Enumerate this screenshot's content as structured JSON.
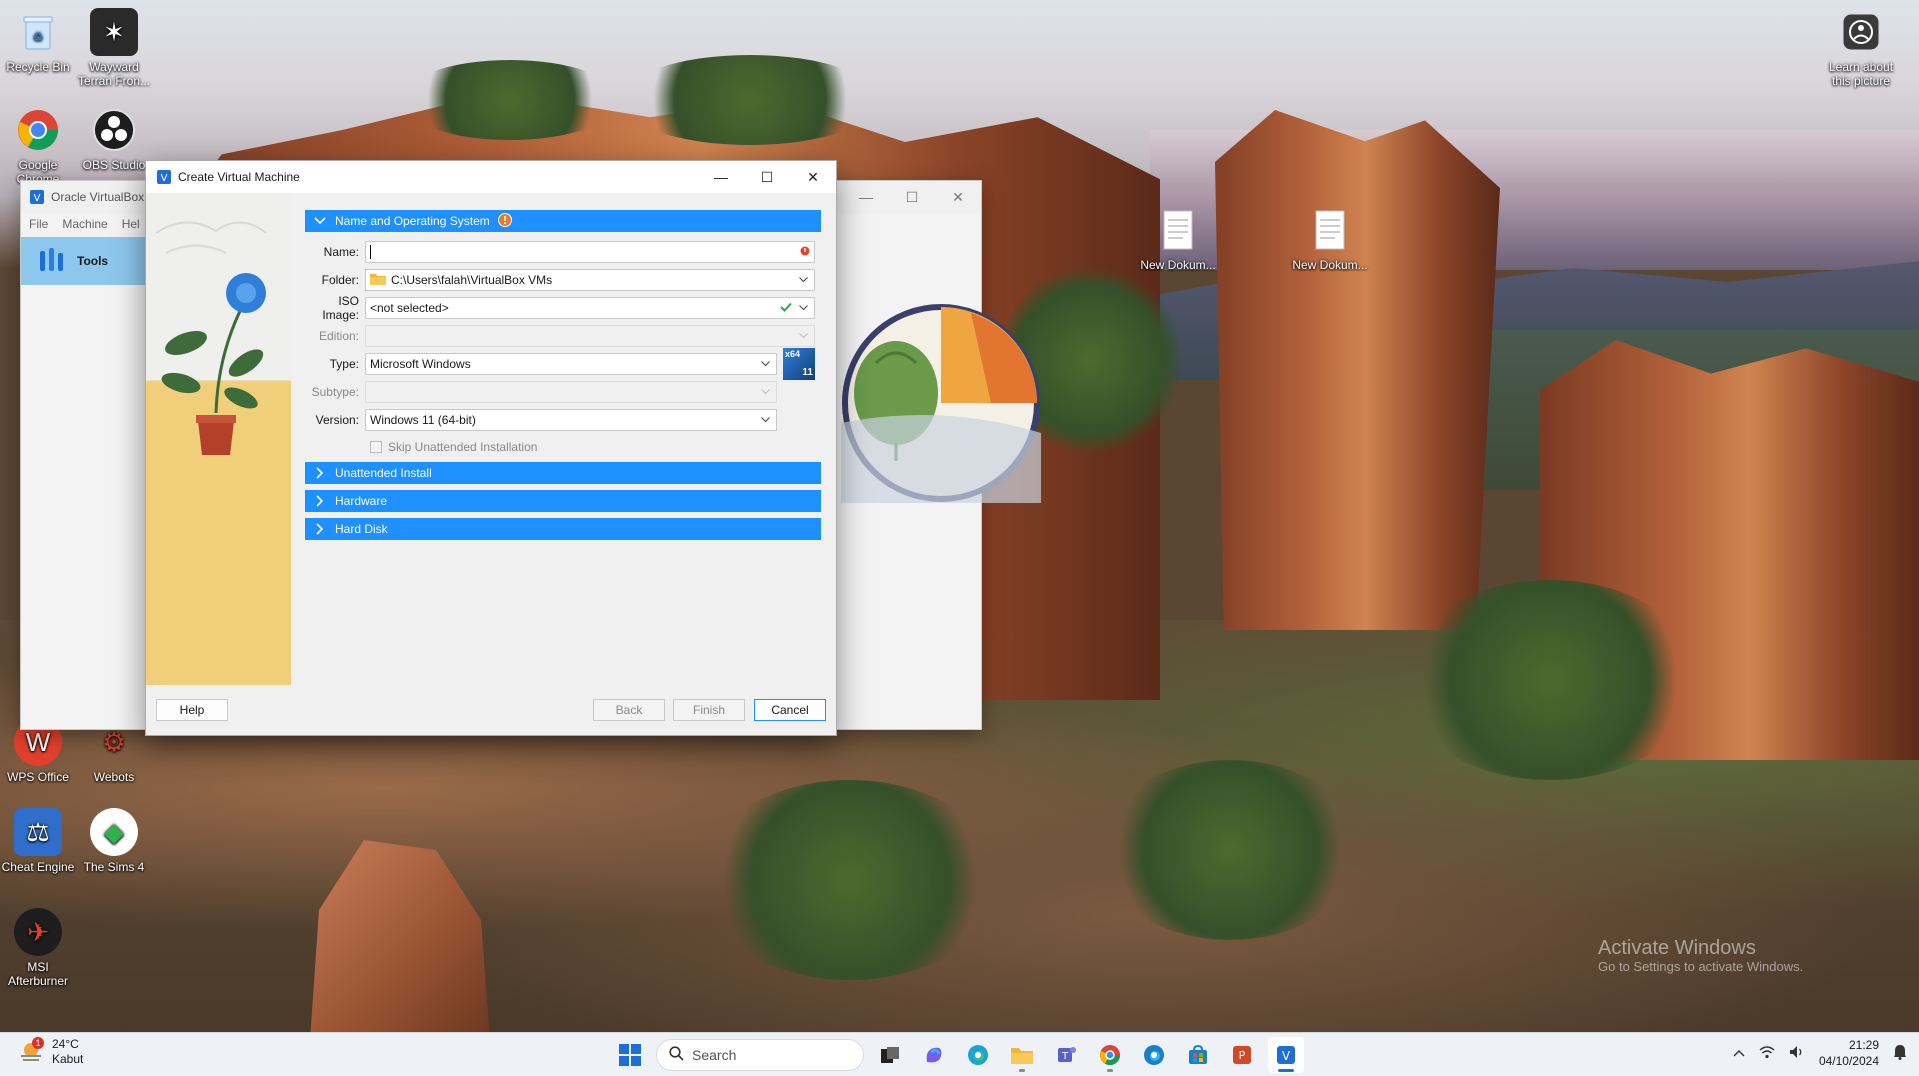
{
  "desktop": {
    "icons": [
      {
        "label": "Recycle Bin",
        "icon": "recycle-bin-icon"
      },
      {
        "label": "Wayward Terran Fron...",
        "icon": "wayward-terran-frontier-icon"
      },
      {
        "label": "Google Chrome",
        "icon": "chrome-icon"
      },
      {
        "label": "OBS Studio",
        "icon": "obs-icon"
      },
      {
        "label": "WPS Office",
        "icon": "wps-office-icon"
      },
      {
        "label": "Webots",
        "icon": "webots-icon"
      },
      {
        "label": "Cheat Engine",
        "icon": "cheat-engine-icon"
      },
      {
        "label": "The Sims 4",
        "icon": "sims4-icon"
      },
      {
        "label": "MSI Afterburner",
        "icon": "msi-afterburner-icon"
      },
      {
        "label": "New Dokum...",
        "icon": "document-icon"
      },
      {
        "label": "New Dokum...",
        "icon": "document-icon"
      },
      {
        "label": "Learn about this picture",
        "icon": "learn-picture-icon"
      }
    ],
    "watermark": {
      "line1": "Activate Windows",
      "line2": "Go to Settings to activate Windows."
    }
  },
  "vbox_manager": {
    "title": "Oracle VirtualBox",
    "menu": [
      "File",
      "Machine",
      "Hel"
    ],
    "tools_label": "Tools"
  },
  "dialog": {
    "title": "Create Virtual Machine",
    "sections": {
      "name_os": "Name and Operating System",
      "unattended": "Unattended Install",
      "hardware": "Hardware",
      "hard_disk": "Hard Disk"
    },
    "fields": {
      "name_label": "Name:",
      "name_value": "",
      "folder_label": "Folder:",
      "folder_value": "C:\\Users\\falah\\VirtualBox VMs",
      "iso_label": "ISO Image:",
      "iso_value": "<not selected>",
      "edition_label": "Edition:",
      "type_label": "Type:",
      "type_value": "Microsoft Windows",
      "subtype_label": "Subtype:",
      "version_label": "Version:",
      "version_value": "Windows 11 (64-bit)",
      "skip_unattended": "Skip Unattended Installation"
    },
    "os_badge": {
      "arch": "x64",
      "ver": "11"
    },
    "buttons": {
      "help": "Help",
      "back": "Back",
      "finish": "Finish",
      "cancel": "Cancel"
    }
  },
  "taskbar": {
    "weather_temp": "24°C",
    "weather_desc": "Kabut",
    "weather_badge": "1",
    "search_placeholder": "Search",
    "time": "21:29",
    "date": "04/10/2024"
  },
  "colors": {
    "accent": "#1e90ff",
    "section_bg": "#1e90ff",
    "dialog_bg": "#f0f0f0"
  }
}
